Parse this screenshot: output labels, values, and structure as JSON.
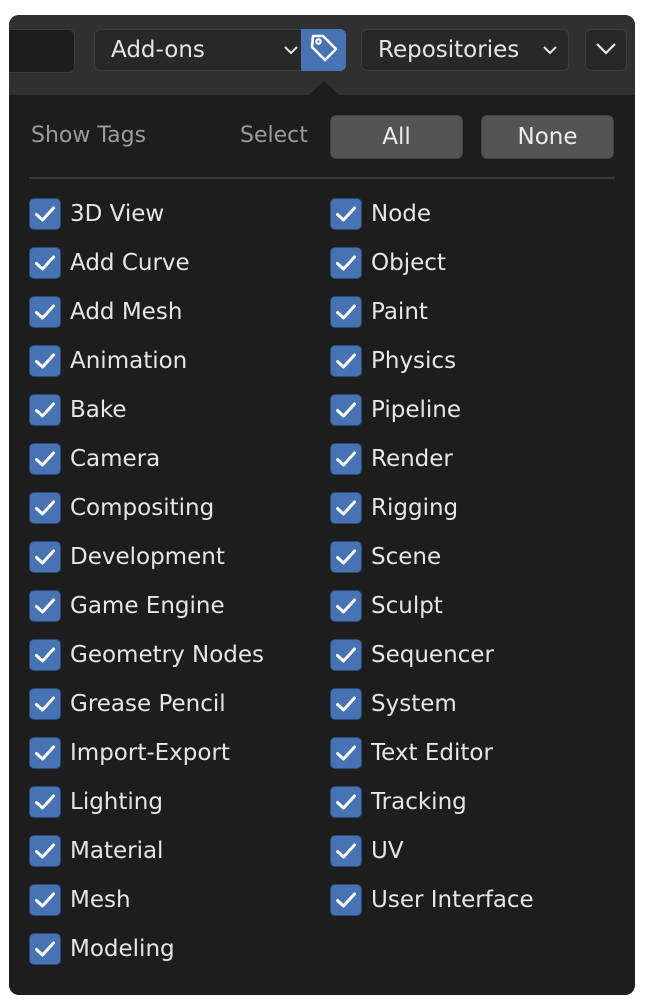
{
  "header": {
    "category_dropdown": "Add-ons",
    "tag_button_icon": "tag-icon",
    "repositories_dropdown": "Repositories",
    "more_icon": "chevron-down-icon"
  },
  "panel": {
    "show_tags_label": "Show Tags",
    "select_label": "Select",
    "all_button": "All",
    "none_button": "None"
  },
  "tags_left": [
    {
      "label": "3D View",
      "checked": true
    },
    {
      "label": "Add Curve",
      "checked": true
    },
    {
      "label": "Add Mesh",
      "checked": true
    },
    {
      "label": "Animation",
      "checked": true
    },
    {
      "label": "Bake",
      "checked": true
    },
    {
      "label": "Camera",
      "checked": true
    },
    {
      "label": "Compositing",
      "checked": true
    },
    {
      "label": "Development",
      "checked": true
    },
    {
      "label": "Game Engine",
      "checked": true
    },
    {
      "label": "Geometry Nodes",
      "checked": true
    },
    {
      "label": "Grease Pencil",
      "checked": true
    },
    {
      "label": "Import-Export",
      "checked": true
    },
    {
      "label": "Lighting",
      "checked": true
    },
    {
      "label": "Material",
      "checked": true
    },
    {
      "label": "Mesh",
      "checked": true
    },
    {
      "label": "Modeling",
      "checked": true
    }
  ],
  "tags_right": [
    {
      "label": "Node",
      "checked": true
    },
    {
      "label": "Object",
      "checked": true
    },
    {
      "label": "Paint",
      "checked": true
    },
    {
      "label": "Physics",
      "checked": true
    },
    {
      "label": "Pipeline",
      "checked": true
    },
    {
      "label": "Render",
      "checked": true
    },
    {
      "label": "Rigging",
      "checked": true
    },
    {
      "label": "Scene",
      "checked": true
    },
    {
      "label": "Sculpt",
      "checked": true
    },
    {
      "label": "Sequencer",
      "checked": true
    },
    {
      "label": "System",
      "checked": true
    },
    {
      "label": "Text Editor",
      "checked": true
    },
    {
      "label": "Tracking",
      "checked": true
    },
    {
      "label": "UV",
      "checked": true
    },
    {
      "label": "User Interface",
      "checked": true
    }
  ],
  "colors": {
    "accent": "#4772b3",
    "panel_bg": "#1d1d1d",
    "header_bg": "#303030",
    "button_bg": "#545454"
  }
}
